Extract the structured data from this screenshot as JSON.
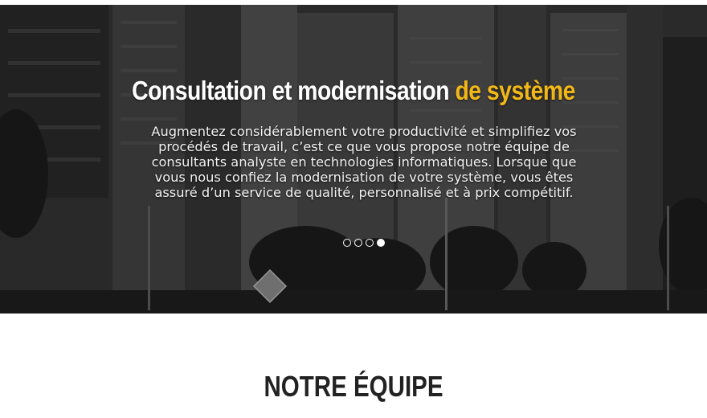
{
  "hero": {
    "title_main": "Consultation et modernisation",
    "title_accent": "de système",
    "accent_color": "#f2b818",
    "description": "Augmentez considérablement votre productivité et simplifiez vos procédés de travail, c’est ce que vous propose notre équipe de consultants analyste en technologies informatiques. Lorsque que vous nous confiez la modernisation de votre système, vous êtes assuré d’un service de qualité, personnalisé et à prix compétitif.",
    "background": "black-and-white city street with skyscrapers",
    "slider": {
      "total": 4,
      "active": 4
    }
  },
  "team_section": {
    "title": "NOTRE ÉQUIPE"
  }
}
